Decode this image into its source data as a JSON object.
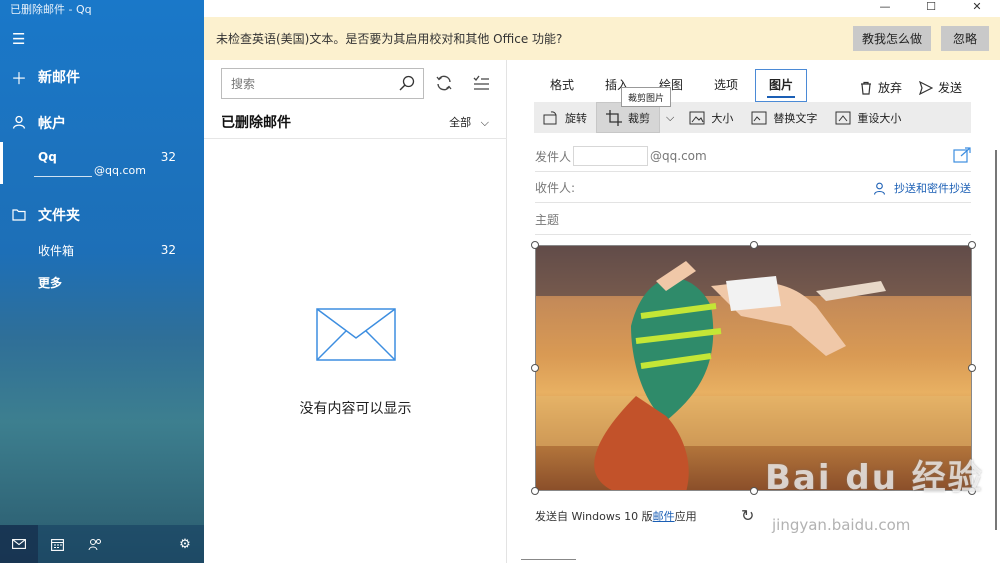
{
  "window": {
    "title": "已删除邮件 - Qq",
    "controls": [
      "—",
      "☐",
      "✕"
    ]
  },
  "nav": {
    "new_mail": "新邮件",
    "accounts_heading": "帐户",
    "account": {
      "name": "Qq",
      "count": "32",
      "email_suffix": "@qq.com"
    },
    "folders_heading": "文件夹",
    "folders": [
      {
        "label": "收件箱",
        "count": "32"
      },
      {
        "label": "更多",
        "count": ""
      }
    ],
    "bottom_icons": [
      "mail-icon",
      "calendar-icon",
      "people-icon",
      "settings-icon"
    ]
  },
  "infobar": {
    "message": "未检查英语(美国)文本。是否要为其启用校对和其他 Office 功能?",
    "show_me": "教我怎么做",
    "ignore": "忽略"
  },
  "list": {
    "search_placeholder": "搜索",
    "folder_title": "已删除邮件",
    "filter": "全部",
    "empty_text": "没有内容可以显示"
  },
  "compose": {
    "tabs": [
      "格式",
      "插入",
      "绘图",
      "选项",
      "图片"
    ],
    "active_tab": "图片",
    "discard": "放弃",
    "send": "发送",
    "ribbon": {
      "rotate": "旋转",
      "crop": "裁剪",
      "size": "大小",
      "alt_text": "替换文字",
      "reset_size": "重设大小"
    },
    "tooltip": "裁剪图片",
    "from_label": "发件人",
    "from_suffix": "@qq.com",
    "to_label": "收件人:",
    "cc_link": "抄送和密件抄送",
    "subject_placeholder": "主题",
    "signature_prefix": "发送自 Windows 10 版",
    "signature_link": "邮件",
    "signature_suffix": "应用"
  },
  "watermark": {
    "main": "Bai du 经验",
    "sub": "jingyan.baidu.com"
  }
}
